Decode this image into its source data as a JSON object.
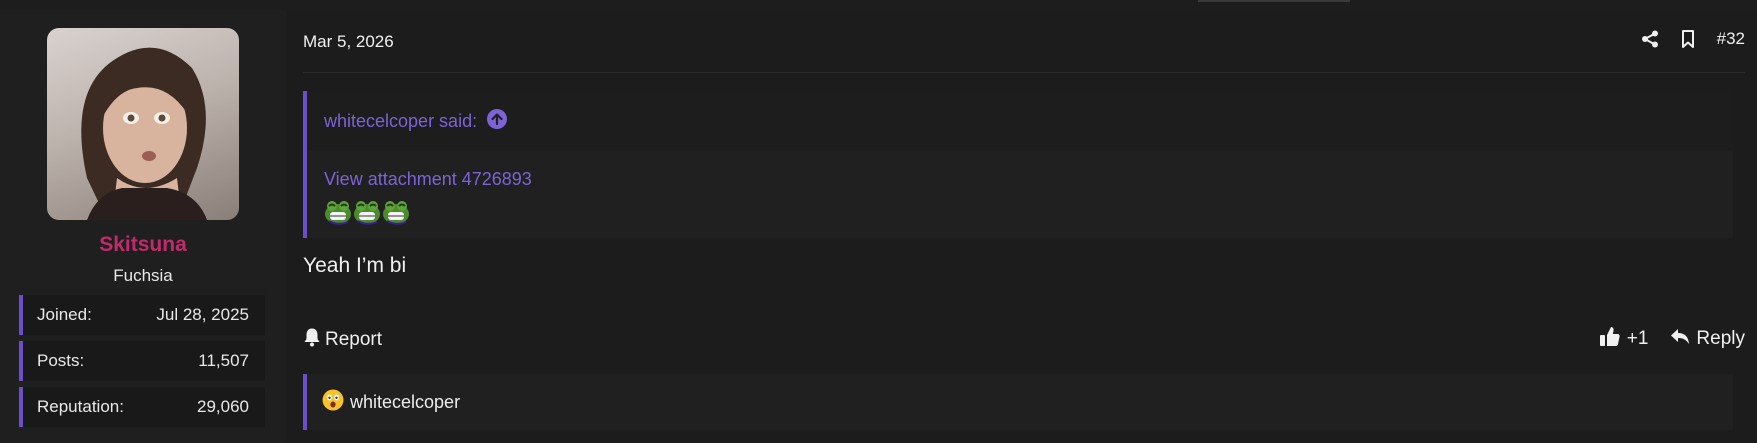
{
  "user": {
    "name": "Skitsuna",
    "title": "Fuchsia",
    "stats": [
      {
        "label": "Joined:",
        "value": "Jul 28, 2025"
      },
      {
        "label": "Posts:",
        "value": "11,507"
      },
      {
        "label": "Reputation:",
        "value": "29,060"
      }
    ]
  },
  "post": {
    "date": "Mar 5, 2026",
    "number": "#32",
    "message": "Yeah I’m bi"
  },
  "quote": {
    "author": "whitecelcoper said:",
    "attachment_link": "View attachment 4726893",
    "emoji_icons": [
      "laughing-frog-emoji",
      "laughing-frog-emoji",
      "laughing-frog-emoji"
    ]
  },
  "actions": {
    "report_label": "Report",
    "like_count": "+1",
    "reply_label": "Reply"
  },
  "reactions": {
    "emoji_icon": "astonished-face-emoji",
    "user": "whitecelcoper"
  },
  "colors": {
    "accent": "#6a4fc8",
    "username": "#c22a6b",
    "link": "#7d63d6",
    "background": "#1c1c1c"
  }
}
